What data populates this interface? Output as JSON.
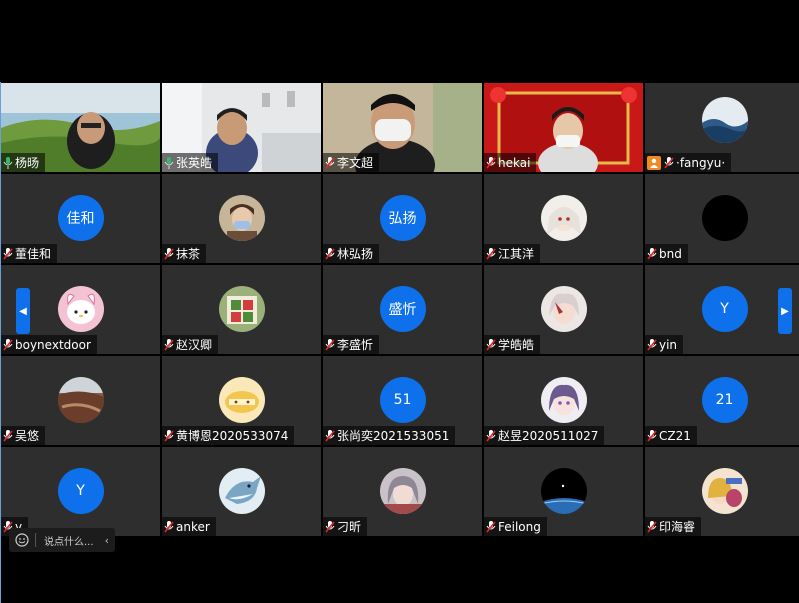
{
  "chat_box": {
    "placeholder": "说点什么...",
    "collapse": "‹"
  },
  "nav": {
    "prev": "◀",
    "next": "▶"
  },
  "participants": [
    {
      "name": "杨旸",
      "mic": "on",
      "video": true
    },
    {
      "name": "张英皓",
      "mic": "on",
      "video": true,
      "speaking": true
    },
    {
      "name": "李文超",
      "mic": "muted",
      "video": true
    },
    {
      "name": "hekai",
      "mic": "muted",
      "video": true
    },
    {
      "name": "·fangyu·",
      "mic": "muted",
      "avatar": "waves-photo",
      "host_badge": true
    },
    {
      "name": "董佳和",
      "mic": "muted",
      "initials": "佳和"
    },
    {
      "name": "抹茶",
      "mic": "muted",
      "avatar": "person-photo"
    },
    {
      "name": "林弘扬",
      "mic": "muted",
      "initials": "弘扬"
    },
    {
      "name": "江其洋",
      "mic": "muted",
      "avatar": "anime-photo"
    },
    {
      "name": "bnd",
      "mic": "muted",
      "avatar": "black-circle"
    },
    {
      "name": "boynextdoor",
      "mic": "muted",
      "avatar": "sanrio-photo"
    },
    {
      "name": "赵汉卿",
      "mic": "muted",
      "avatar": "sign-photo"
    },
    {
      "name": "李盛忻",
      "mic": "muted",
      "initials": "盛忻"
    },
    {
      "name": "学皓皓",
      "mic": "muted",
      "avatar": "anime-photo-2"
    },
    {
      "name": "yin",
      "mic": "muted",
      "initials": "Y"
    },
    {
      "name": "吴悠",
      "mic": "muted",
      "avatar": "nature-photo"
    },
    {
      "name": "黄博恩2020533074",
      "mic": "muted",
      "avatar": "cartoon-photo"
    },
    {
      "name": "张尚奕2021533051",
      "mic": "muted",
      "initials": "51"
    },
    {
      "name": "赵昱2020511027",
      "mic": "muted",
      "avatar": "anime-photo-3"
    },
    {
      "name": "CZ21",
      "mic": "muted",
      "initials": "21"
    },
    {
      "name": "y",
      "mic": "muted",
      "initials": "Y"
    },
    {
      "name": "anker",
      "mic": "muted",
      "avatar": "shark-photo"
    },
    {
      "name": "刁昕",
      "mic": "muted",
      "avatar": "anime-photo-4"
    },
    {
      "name": "Feilong",
      "mic": "muted",
      "avatar": "space-photo"
    },
    {
      "name": "印海睿",
      "mic": "muted",
      "avatar": "anime-photo-5"
    }
  ],
  "colors": {
    "accent": "#0e71eb",
    "tile_bg": "#2e2e2e",
    "speaking": "#35b86f",
    "host_badge": "#f08a24"
  }
}
